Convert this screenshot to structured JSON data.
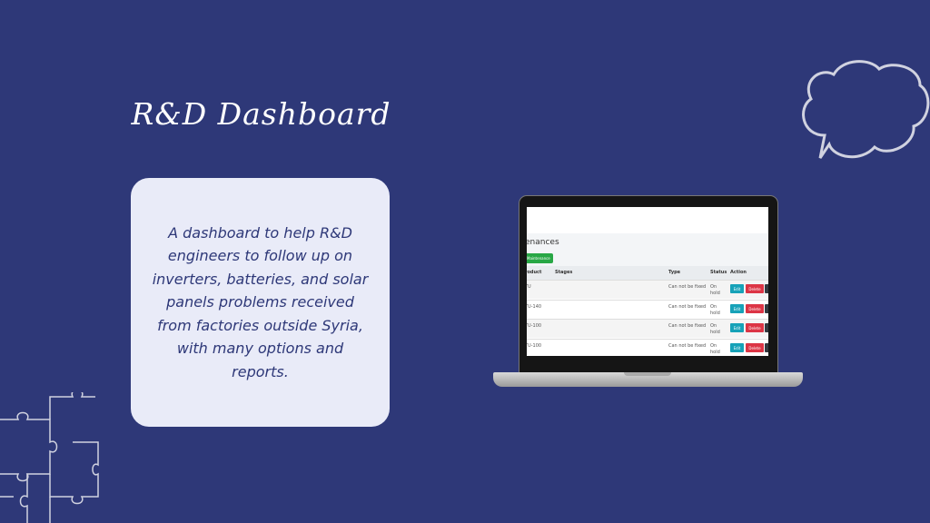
{
  "slide": {
    "title": "R&D Dashboard",
    "description": "A dashboard to help R&D engineers to follow up on inverters, batteries, and solar panels problems received from factories outside Syria, with many options and reports."
  },
  "screen": {
    "page_title": "enances",
    "add_button": "Maintenance",
    "columns": [
      "roduct",
      "Stages",
      "Type",
      "Status",
      "Action"
    ],
    "rows": [
      {
        "product": "TU",
        "stages": "",
        "type": "Can not be fixed",
        "status": "On hold"
      },
      {
        "product": "TU-140",
        "stages": "",
        "type": "Can not be fixed",
        "status": "On hold"
      },
      {
        "product": "TU-100",
        "stages": "",
        "type": "Can not be fixed",
        "status": "On hold"
      },
      {
        "product": "TU-100",
        "stages": "",
        "type": "Can not be fixed",
        "status": "On hold"
      }
    ],
    "edit_label": "Edit",
    "delete_label": "Delete"
  },
  "colors": {
    "background": "#2e3878",
    "card": "#e9ebf8",
    "edit": "#17a2b8",
    "delete": "#dc3545",
    "add": "#28a745"
  }
}
